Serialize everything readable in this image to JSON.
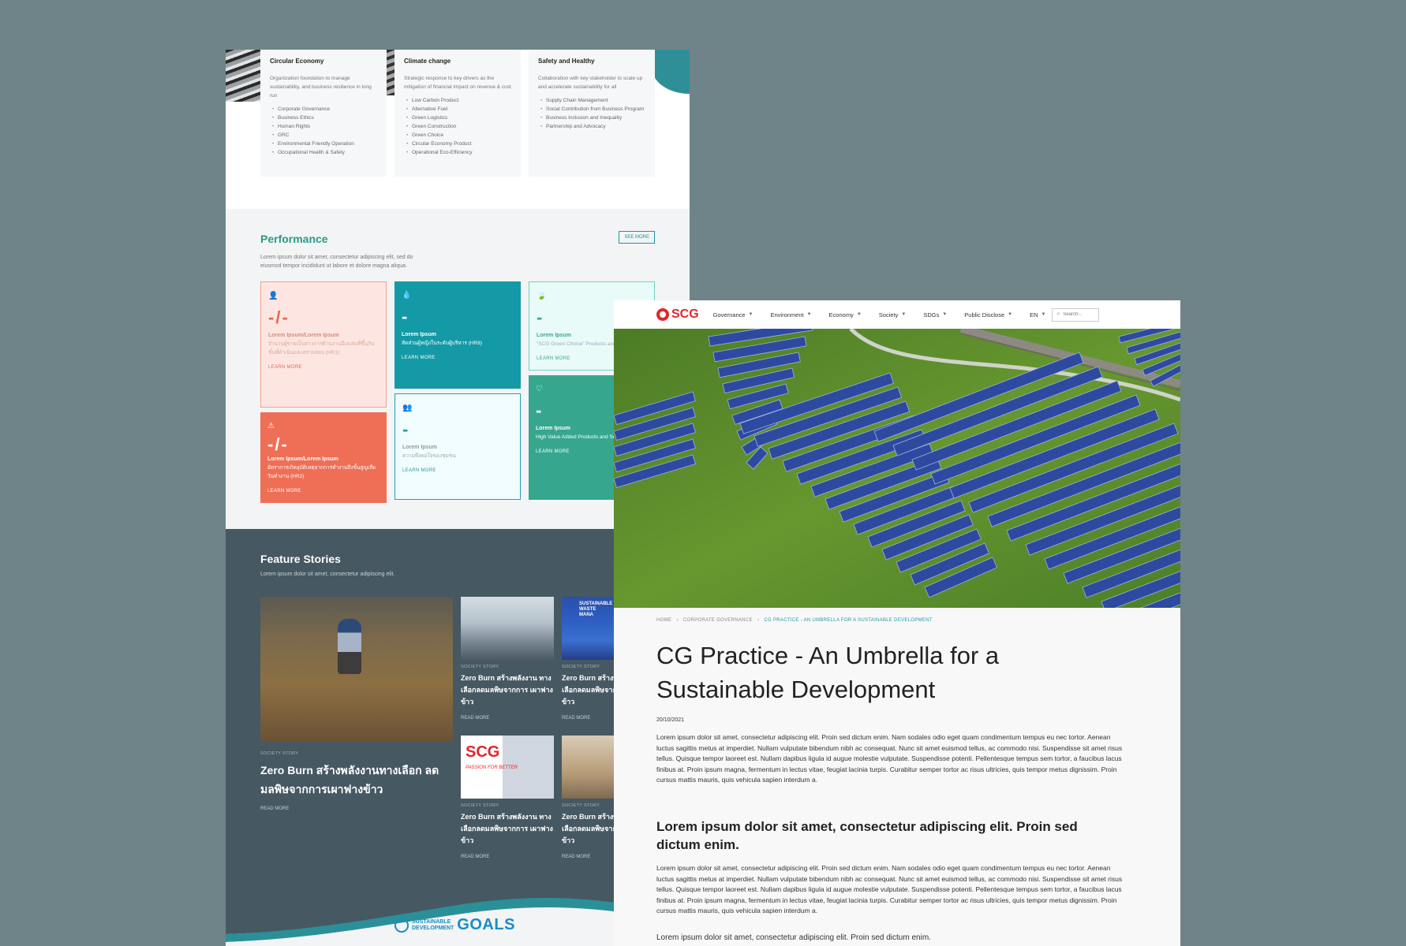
{
  "pillars": [
    {
      "title": "Circular Economy",
      "desc": "Organization foundation to manage sustainability, and business resilience in long run",
      "items": [
        "Corporate Governance",
        "Business Ethics",
        "Human Rights",
        "GRC",
        "Environmental Friendly Operation",
        "Occupational Health & Safety"
      ]
    },
    {
      "title": "Climate change",
      "desc": "Strategic response to key drivers as the mitigation of financial impact on revenue & cost",
      "items": [
        "Low Carbon Product",
        "Alternative Fuel",
        "Green Logistics",
        "Green Construction",
        "Green Choice",
        "Circular Economy Product",
        "Operational Eco-Efficiency"
      ]
    },
    {
      "title": "Safety and Healthy",
      "desc": "Collaboration with key stakeholder to scale up and accelerate sustainability for all",
      "items": [
        "Supply Chain Management",
        "Social Contribution from Business Program",
        "Business Inclusion and Inequality",
        "Partnership and Advocacy"
      ]
    }
  ],
  "performance": {
    "title": "Performance",
    "desc": "Lorem ipsum dolor sit amet, consectetur adipiscing elit, sed do eiusmod tempor incididunt ut labore et dolore magna aliqua.",
    "see_more": "SEE MORE",
    "tiles": [
      {
        "icon": "👤",
        "num": "-/-",
        "label": "Lorem Ipsum/Lorem Ipsum",
        "sub": "จำนวนผู้ขายเป็นทางการด้านงานอีเลเล่นที่ขึ้นกับขั้นที่ดำเนินและตรวจสอบ (HR1)",
        "learn": "LEARN MORE"
      },
      {
        "icon": "💧",
        "num": "-",
        "label": "Lorem Ipsum",
        "sub": "สัดส่วนผู้หญิงในระดับผู้บริหาร (HR8)",
        "learn": "LEARN MORE"
      },
      {
        "icon": "🍃",
        "num": "-",
        "label": "Lorem Ipsum",
        "sub": "\"SCG Green Choice\" Products and Services",
        "learn": "LEARN MORE"
      },
      {
        "icon": "⚠",
        "num": "-/-",
        "label": "Lorem Ipsum/Lorem Ipsum",
        "sub": "อัตราการเกิดอุบัติเหตุจากการทำงานถึงขั้นสูญเสียวันทำงาน (HR2)",
        "learn": "LEARN MORE"
      },
      {
        "icon": "👥",
        "num": "-",
        "label": "Lorem Ipsum",
        "sub": "ความพึงพอใจของชุมชน",
        "learn": "LEARN MORE"
      },
      {
        "icon": "♡",
        "num": "-",
        "label": "Lorem Ipsum",
        "sub": "High Value Added Products and Services",
        "learn": "LEARN MORE"
      }
    ]
  },
  "stories": {
    "title": "Feature Stories",
    "desc": "Lorem ipsum dolor sit amet, consectetur adipiscing elit.",
    "main": {
      "category": "SOCIETY STORY",
      "title": "Zero Burn สร้างพลังงานทางเลือก ลดมลพิษจากการเผาฟางข้าว",
      "read_more": "READ MORE"
    },
    "small": [
      {
        "category": "SOCIETY STORY",
        "title": "Zero Burn สร้างพลังงาน ทางเลือกลดมลพิษจากการ เผาฟางข้าว",
        "read_more": "READ MORE"
      },
      {
        "category": "SOCIETY STORY",
        "title": "Zero Burn สร้างพลังงาน ทางเลือกลดมลพิษจากการ เผาฟางข้าว",
        "read_more": "READ MORE"
      },
      {
        "category": "SOCIETY STORY",
        "title": "Zero Burn สร้างพลังงาน ทางเลือกลดมลพิษจากการ เผาฟางข้าว",
        "read_more": "READ MORE"
      },
      {
        "category": "SOCIETY STORY",
        "title": "Zero Burn สร้างพลังงาน ทางเลือกลดมลพิษจากการ เผาฟางข้าว",
        "read_more": "READ MORE"
      }
    ],
    "scg_tagline": "PASSION FOR BETTER",
    "event_banner": "SUSTAINABLE WASTE MANA"
  },
  "sdg": {
    "small_line1": "SUSTAINABLE",
    "small_line2": "DEVELOPMENT",
    "goals": "GOALS"
  },
  "nav": {
    "logo": "SCG",
    "items": [
      "Governance",
      "Environment",
      "Economy",
      "Society",
      "SDGs",
      "Public Disclose"
    ],
    "lang": "EN",
    "search_placeholder": "Search..."
  },
  "article": {
    "breadcrumb": [
      "HOME",
      "CORPORATE GOVERNANCE",
      "CG PRACTICE - AN UMBRELLA FOR A SUSTAINABLE DEVELOPMENT"
    ],
    "title": "CG Practice - An Umbrella for a Sustainable Development",
    "date": "20/10/2021",
    "para1": "Lorem ipsum dolor sit amet, consectetur adipiscing elit. Proin sed dictum enim. Nam sodales odio eget quam condimentum tempus eu nec tortor. Aenean luctus sagittis metus at imperdiet. Nullam vulputate bibendum nibh ac consequat. Nunc sit amet euismod tellus, ac commodo nisi. Suspendisse sit amet risus tellus. Quisque tempor laoreet est. Nullam dapibus ligula id augue molestie vulputate. Suspendisse potenti. Pellentesque tempus sem tortor, a faucibus lacus finibus at. Proin ipsum magna, fermentum in lectus vitae, feugiat lacinia turpis. Curabitur semper tortor ac risus ultricies, quis tempor metus dignissim. Proin cursus mattis mauris, quis vehicula sapien interdum a.",
    "subhead": "Lorem ipsum dolor sit amet, consectetur adipiscing elit. Proin sed dictum enim.",
    "para2": "Lorem ipsum dolor sit amet, consectetur adipiscing elit. Proin sed dictum enim. Nam sodales odio eget quam condimentum tempus eu nec tortor. Aenean luctus sagittis metus at imperdiet. Nullam vulputate bibendum nibh ac consequat. Nunc sit amet euismod tellus, ac commodo nisi. Suspendisse sit amet risus tellus. Quisque tempor laoreet est. Nullam dapibus ligula id augue molestie vulputate. Suspendisse potenti. Pellentesque tempus sem tortor, a faucibus lacus finibus at. Proin ipsum magna, fermentum in lectus vitae, feugiat lacinia turpis. Curabitur semper tortor ac risus ultricies, quis tempor metus dignissim. Proin cursus mattis mauris, quis vehicula sapien interdum a.",
    "para3": "Lorem ipsum dolor sit amet, consectetur adipiscing elit. Proin sed dictum enim."
  },
  "colors": {
    "brand_red": "#e2252b",
    "teal": "#1e98a5",
    "green": "#2c9a86",
    "coral": "#ef6e56",
    "slate": "#465862"
  }
}
